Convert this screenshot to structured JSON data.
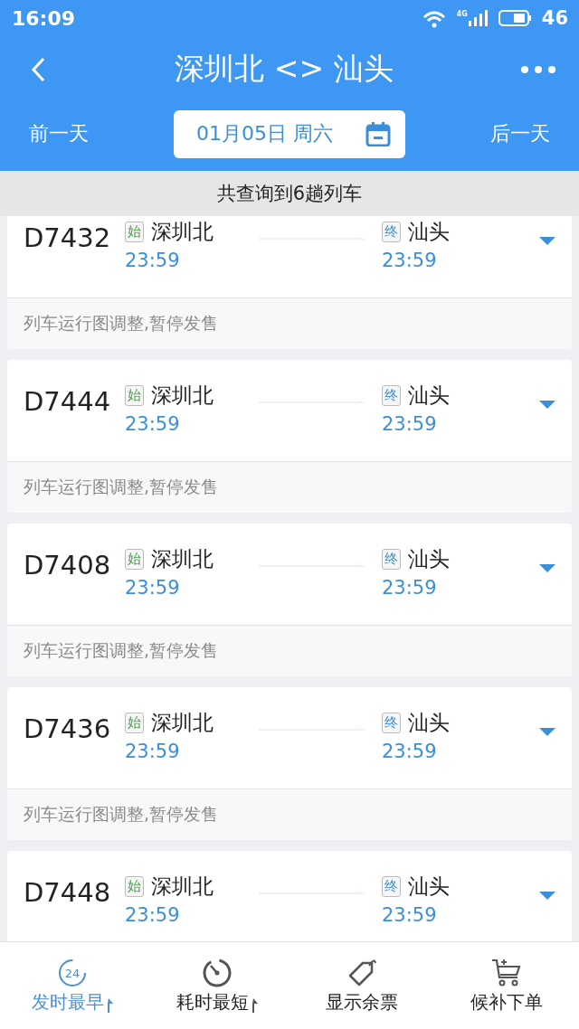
{
  "status_bar": {
    "time": "16:09",
    "network": "4G",
    "battery": "46"
  },
  "header": {
    "title": "深圳北 <> 汕头"
  },
  "date_bar": {
    "prev": "前一天",
    "date": "01月05日 周六",
    "next": "后一天"
  },
  "summary": "共查询到6趟列车",
  "trains": [
    {
      "number": "D7432",
      "from_badge": "始",
      "from": "深圳北",
      "depart": "23:59",
      "to_badge": "终",
      "to": "汕头",
      "arrive": "23:59",
      "note": "列车运行图调整,暂停发售"
    },
    {
      "number": "D7444",
      "from_badge": "始",
      "from": "深圳北",
      "depart": "23:59",
      "to_badge": "终",
      "to": "汕头",
      "arrive": "23:59",
      "note": "列车运行图调整,暂停发售"
    },
    {
      "number": "D7408",
      "from_badge": "始",
      "from": "深圳北",
      "depart": "23:59",
      "to_badge": "终",
      "to": "汕头",
      "arrive": "23:59",
      "note": "列车运行图调整,暂停发售"
    },
    {
      "number": "D7436",
      "from_badge": "始",
      "from": "深圳北",
      "depart": "23:59",
      "to_badge": "终",
      "to": "汕头",
      "arrive": "23:59",
      "note": "列车运行图调整,暂停发售"
    },
    {
      "number": "D7448",
      "from_badge": "始",
      "from": "深圳北",
      "depart": "23:59",
      "to_badge": "终",
      "to": "汕头",
      "arrive": "23:59"
    }
  ],
  "tabs": [
    {
      "label": "发时最早",
      "kind": "clock",
      "icon_text": "24",
      "sort": true,
      "selected": true
    },
    {
      "label": "耗时最短",
      "kind": "stopwatch",
      "sort": true,
      "selected": false
    },
    {
      "label": "显示余票",
      "kind": "tag",
      "sort": false,
      "selected": false
    },
    {
      "label": "候补下单",
      "kind": "cart",
      "sort": false,
      "selected": false
    }
  ]
}
